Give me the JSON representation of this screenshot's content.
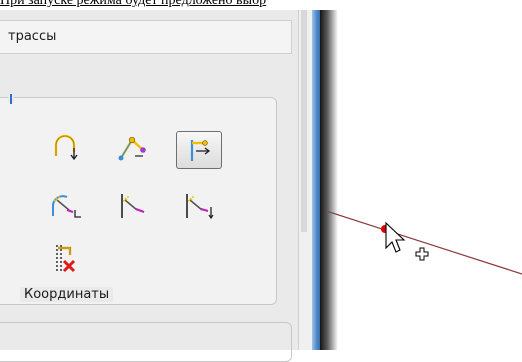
{
  "top_caption": "При запуске режима будет предложено выбр",
  "route_section": {
    "label": "трассы"
  },
  "tool_group": {
    "tools": [
      {
        "name": "arc-tool",
        "selected": false
      },
      {
        "name": "branch-tool",
        "selected": false
      },
      {
        "name": "extend-right-tool",
        "selected": true
      },
      {
        "name": "wand-arc-tool",
        "selected": false
      },
      {
        "name": "wand-vertical-tool",
        "selected": false
      },
      {
        "name": "wand-edit-tool",
        "selected": false
      },
      {
        "name": "delete-tool",
        "selected": false
      }
    ]
  },
  "coordinates": {
    "label": "Координаты"
  },
  "colors": {
    "line": "#8b3a3a",
    "point": "#e00000",
    "frame": "#4f87c6",
    "tool_accent": "#f0c000"
  }
}
